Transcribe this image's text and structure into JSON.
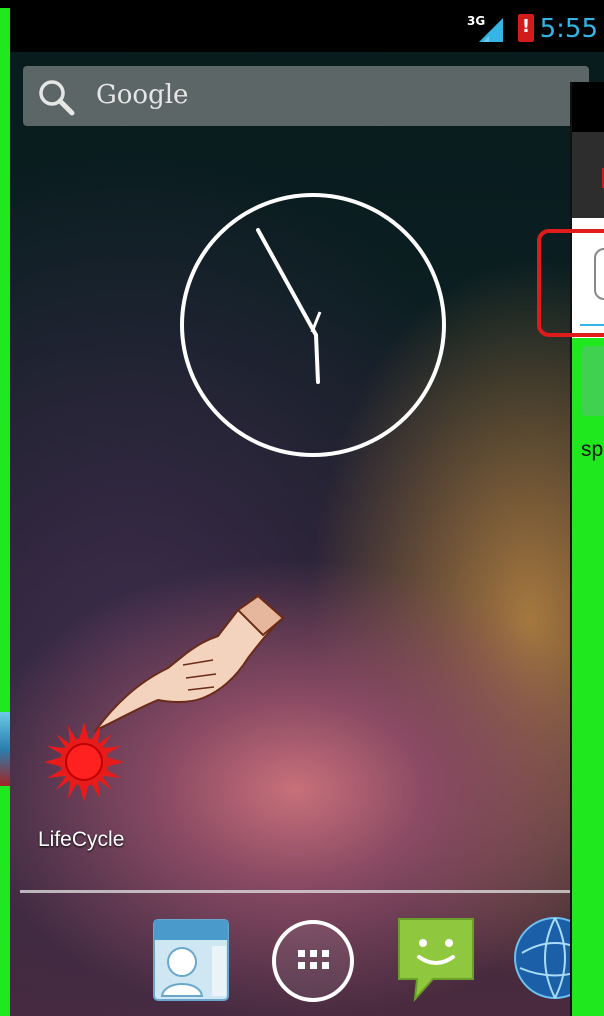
{
  "status_bar": {
    "time": "5:55",
    "network_type": "3G",
    "battery_warning": "!",
    "time_color": "#33b5e5"
  },
  "search_bar": {
    "label": "Google",
    "icon": "search-icon"
  },
  "widgets": {
    "analog_clock": {
      "icon": "analog-clock-widget"
    }
  },
  "home_apps": [
    {
      "label": "LifeCycle",
      "icon": "red-sun-icon"
    }
  ],
  "pointer": {
    "icon": "pointing-hand-icon"
  },
  "dock": [
    {
      "icon": "contacts-icon"
    },
    {
      "icon": "app-drawer-icon"
    },
    {
      "icon": "messaging-icon"
    },
    {
      "icon": "browser-globe-icon"
    }
  ],
  "overlay_window": {
    "partial_text": "sp",
    "highlight_color": "#e01b1b"
  }
}
